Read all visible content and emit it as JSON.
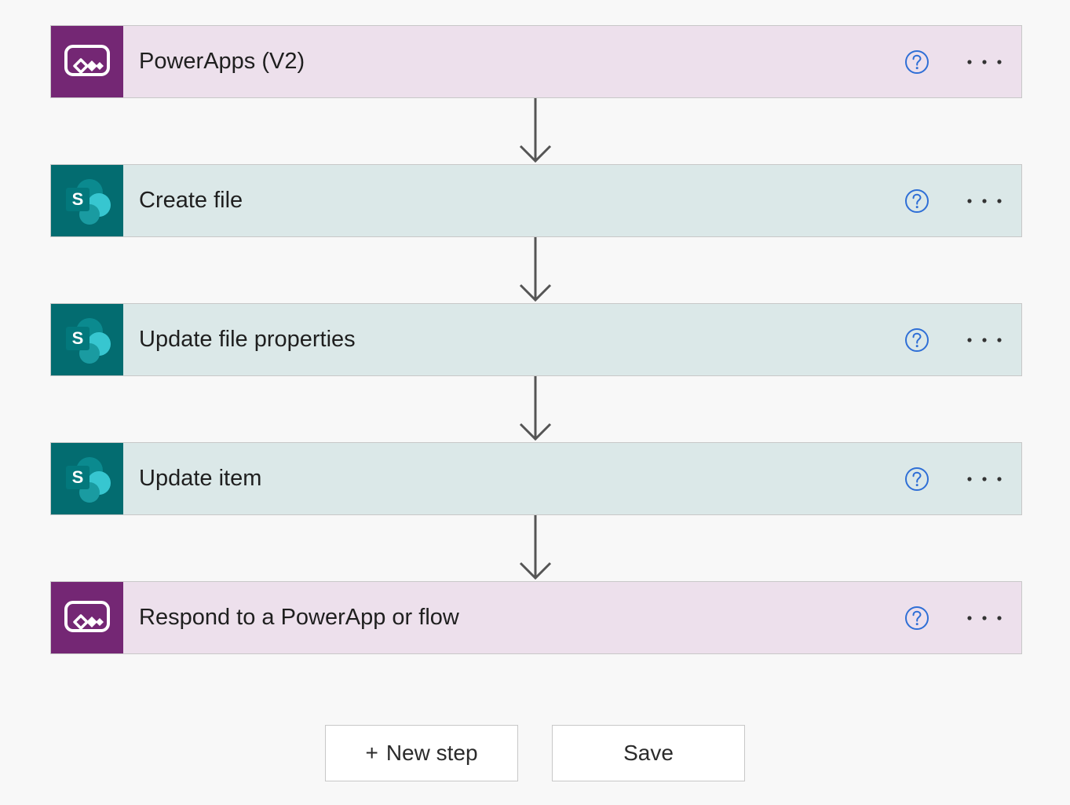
{
  "flow": {
    "steps": [
      {
        "title": "PowerApps (V2)",
        "connector": "powerapps",
        "icon": "powerapps-icon"
      },
      {
        "title": "Create file",
        "connector": "sharepoint",
        "icon": "sharepoint-icon"
      },
      {
        "title": "Update file properties",
        "connector": "sharepoint",
        "icon": "sharepoint-icon"
      },
      {
        "title": "Update item",
        "connector": "sharepoint",
        "icon": "sharepoint-icon"
      },
      {
        "title": "Respond to a PowerApp or flow",
        "connector": "powerapps",
        "icon": "powerapps-icon"
      }
    ]
  },
  "actions": {
    "new_step_plus": "+",
    "new_step_label": "New step",
    "save_label": "Save"
  },
  "colors": {
    "powerapps_brand": "#742774",
    "powerapps_card_bg": "#ede0ec",
    "sharepoint_brand": "#036c70",
    "sharepoint_card_bg": "#dbe8e8",
    "help_icon": "#2f6fd6",
    "connector_arrow": "#555555"
  }
}
